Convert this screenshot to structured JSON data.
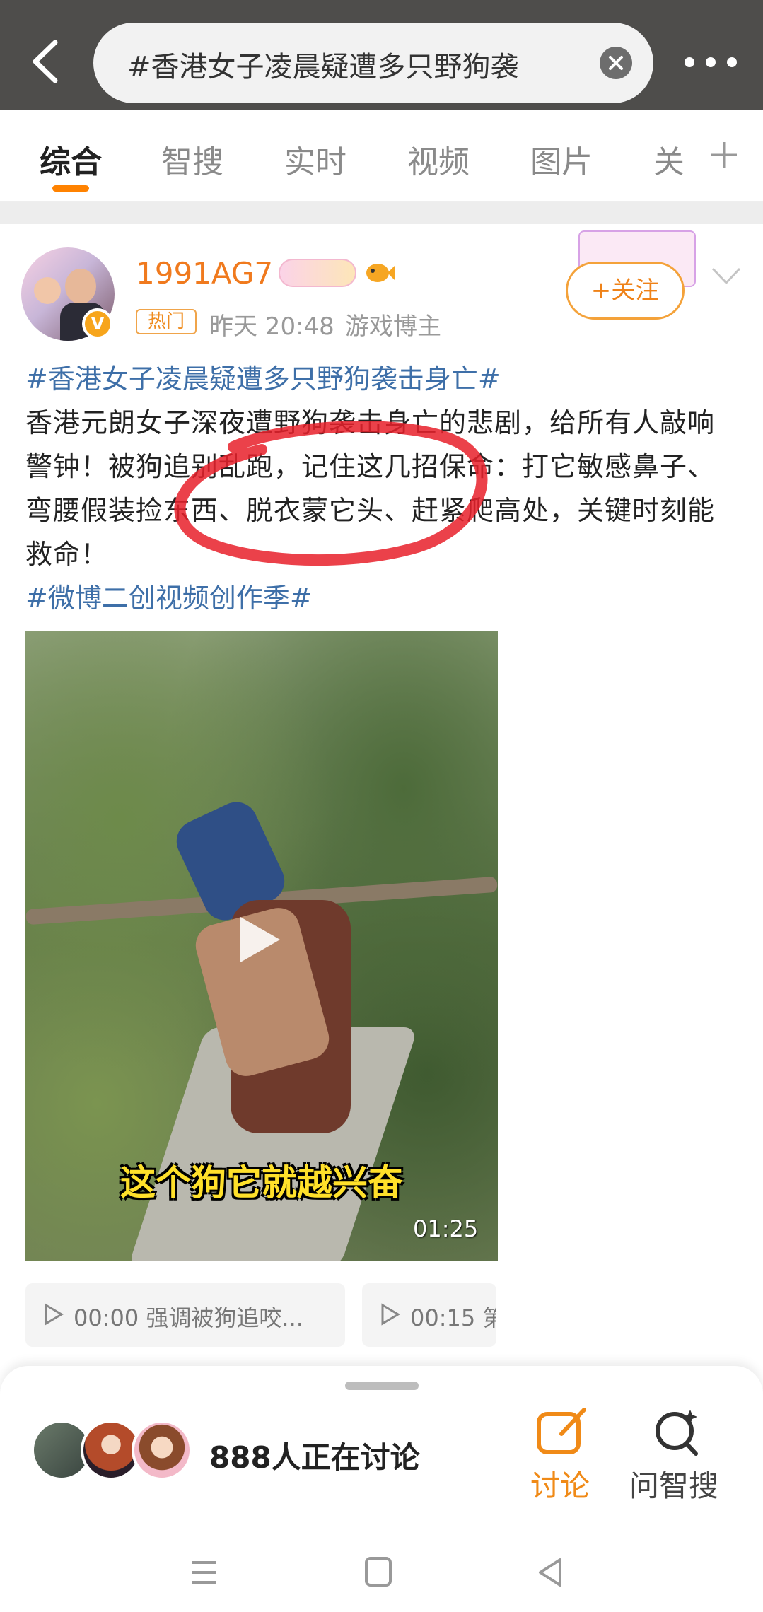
{
  "search": {
    "query": "#香港女子凌晨疑遭多只野狗袭",
    "back_icon": "chevron-left-icon",
    "clear_icon": "close-circle-icon",
    "more_icon": "more-dots-icon"
  },
  "tabs": [
    {
      "label": "综合",
      "active": true
    },
    {
      "label": "智搜",
      "active": false
    },
    {
      "label": "实时",
      "active": false
    },
    {
      "label": "视频",
      "active": false
    },
    {
      "label": "图片",
      "active": false
    },
    {
      "label": "关",
      "active": false
    }
  ],
  "post": {
    "username": "1991AG7",
    "hot_tag": "热门",
    "time": "昨天 20:48",
    "role": "游戏博主",
    "follow_label": "+关注",
    "verified_mark": "V",
    "hashtag_title": "#香港女子凌晨疑遭多只野狗袭击身亡#",
    "body": "香港元朗女子深夜遭野狗袭击身亡的悲剧，给所有人敲响警钟！被狗追别乱跑，记住这几招保命：打它敏感鼻子、弯腰假装捡东西、脱衣蒙它头、赶紧爬高处，关键时刻能救命！",
    "hashtag_footer": "#微博二创视频创作季#",
    "video": {
      "subtitle": "这个狗它就越兴奋",
      "duration": "01:25"
    },
    "chapters": [
      {
        "time": "00:00",
        "text": "强调被狗追咬..."
      },
      {
        "time": "00:15",
        "text": "第"
      }
    ]
  },
  "bottom_sheet": {
    "discuss_count": "888人正在讨论",
    "discuss_label": "讨论",
    "zhisou_label": "问智搜"
  },
  "colors": {
    "accent": "#ff8200",
    "hashtag": "#3e6fa8",
    "annotation": "#e8202a"
  }
}
